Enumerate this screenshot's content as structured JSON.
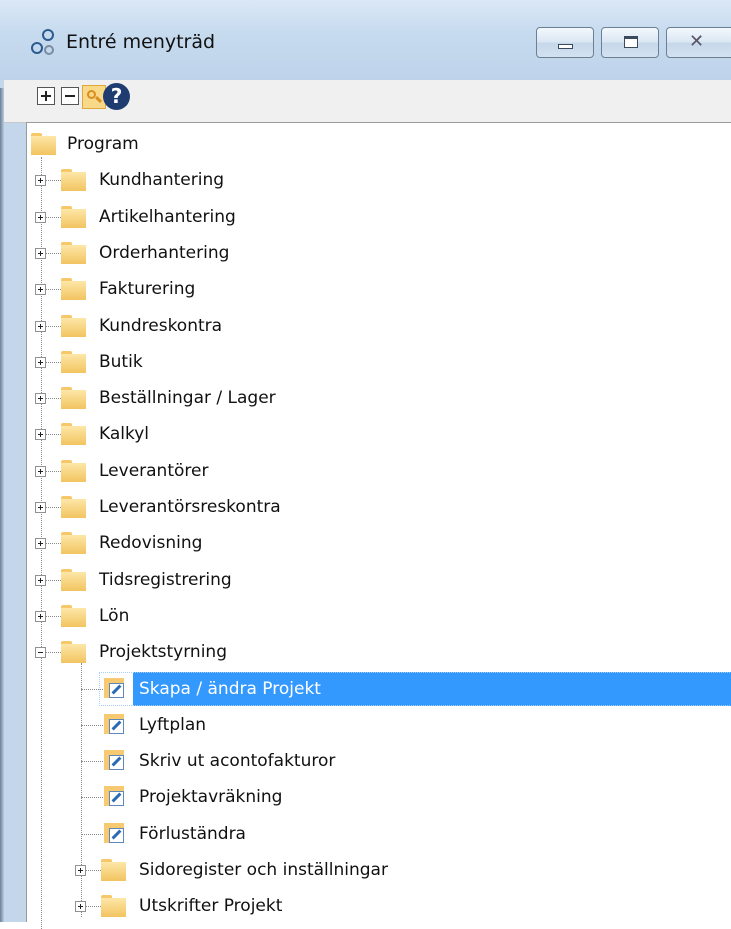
{
  "window": {
    "title": "Entré menyträd",
    "app_icon": "connector-nodes-icon",
    "buttons": {
      "minimize": "minimize-icon",
      "maximize": "maximize-icon",
      "close": "close-icon"
    }
  },
  "toolbar": {
    "items": [
      {
        "name": "expand-all",
        "icon": "plus-box-icon"
      },
      {
        "name": "collapse-all",
        "icon": "minus-box-icon"
      },
      {
        "name": "search",
        "icon": "magnifier-icon"
      },
      {
        "name": "help",
        "icon": "question-icon",
        "glyph": "?"
      }
    ]
  },
  "tree": {
    "root": {
      "label": "Program",
      "icon": "folder-icon"
    },
    "items": [
      {
        "label": "Kundhantering",
        "icon": "folder-icon",
        "expander": "+",
        "level": 1
      },
      {
        "label": "Artikelhantering",
        "icon": "folder-icon",
        "expander": "+",
        "level": 1
      },
      {
        "label": "Orderhantering",
        "icon": "folder-icon",
        "expander": "+",
        "level": 1
      },
      {
        "label": "Fakturering",
        "icon": "folder-icon",
        "expander": "+",
        "level": 1
      },
      {
        "label": "Kundreskontra",
        "icon": "folder-icon",
        "expander": "+",
        "level": 1
      },
      {
        "label": "Butik",
        "icon": "folder-icon",
        "expander": "+",
        "level": 1
      },
      {
        "label": "Beställningar / Lager",
        "icon": "folder-icon",
        "expander": "+",
        "level": 1
      },
      {
        "label": "Kalkyl",
        "icon": "folder-icon",
        "expander": "+",
        "level": 1
      },
      {
        "label": "Leverantörer",
        "icon": "folder-icon",
        "expander": "+",
        "level": 1
      },
      {
        "label": "Leverantörsreskontra",
        "icon": "folder-icon",
        "expander": "+",
        "level": 1
      },
      {
        "label": "Redovisning",
        "icon": "folder-icon",
        "expander": "+",
        "level": 1
      },
      {
        "label": "Tidsregistrering",
        "icon": "folder-icon",
        "expander": "+",
        "level": 1
      },
      {
        "label": "Lön",
        "icon": "folder-icon",
        "expander": "+",
        "level": 1
      },
      {
        "label": "Projektstyrning",
        "icon": "folder-icon",
        "expander": "-",
        "level": 1
      },
      {
        "label": "Skapa / ändra Projekt",
        "icon": "form-document-icon",
        "expander": "",
        "level": 2,
        "selected": true
      },
      {
        "label": "Lyftplan",
        "icon": "form-document-icon",
        "expander": "",
        "level": 2
      },
      {
        "label": "Skriv ut acontofakturor",
        "icon": "form-document-icon",
        "expander": "",
        "level": 2
      },
      {
        "label": "Projektavräkning",
        "icon": "form-document-icon",
        "expander": "",
        "level": 2
      },
      {
        "label": "Förluständra",
        "icon": "form-document-icon",
        "expander": "",
        "level": 2
      },
      {
        "label": "Sidoregister och inställningar",
        "icon": "folder-icon",
        "expander": "+",
        "level": 2
      },
      {
        "label": "Utskrifter Projekt",
        "icon": "folder-icon",
        "expander": "+",
        "level": 2
      }
    ]
  },
  "colors": {
    "selection": "#3399ff",
    "folder": "#f6c86a",
    "titlebar": "#c4d7ea"
  }
}
